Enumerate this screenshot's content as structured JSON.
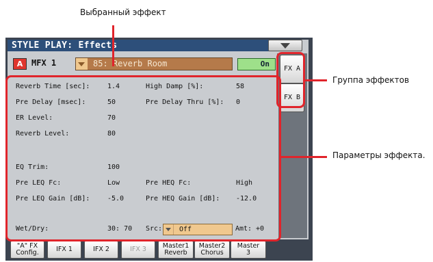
{
  "callouts": {
    "selected_effect": "Выбранный эффект",
    "effects_group": "Группа эффектов",
    "effect_params": "Параметры эффекта."
  },
  "window": {
    "title": "STYLE PLAY: Effects"
  },
  "effect_row": {
    "slot_button": "A",
    "mfx_label": "MFX 1",
    "effect_name": "85: Reverb Room",
    "on_label": "On"
  },
  "side_tabs": [
    "FX A",
    "FX B"
  ],
  "params": {
    "reverb_time_label": "Reverb Time [sec]:",
    "reverb_time_value": "1.4",
    "high_damp_label": "High Damp [%]:",
    "high_damp_value": "58",
    "pre_delay_label": "Pre Delay [msec]:",
    "pre_delay_value": "50",
    "pre_delay_thru_label": "Pre Delay Thru [%]:",
    "pre_delay_thru_value": "0",
    "er_level_label": "ER Level:",
    "er_level_value": "70",
    "reverb_level_label": "Reverb Level:",
    "reverb_level_value": "80",
    "eq_trim_label": "EQ Trim:",
    "eq_trim_value": "100",
    "pre_leq_fc_label": "Pre LEQ Fc:",
    "pre_leq_fc_value": "Low",
    "pre_heq_fc_label": "Pre HEQ Fc:",
    "pre_heq_fc_value": "High",
    "pre_leq_gain_label": "Pre LEQ Gain [dB]:",
    "pre_leq_gain_value": "-5.0",
    "pre_heq_gain_label": "Pre HEQ Gain [dB]:",
    "pre_heq_gain_value": "-12.0",
    "wet_dry_label": "Wet/Dry:",
    "wet_dry_value": "30: 70",
    "src_label": "Src:",
    "src_value": "Off",
    "amt_label": "Amt:",
    "amt_value": "+0"
  },
  "bottom_tabs": [
    {
      "line1": "\"A\" FX",
      "line2": "Config."
    },
    {
      "line1": "IFX 1",
      "line2": ""
    },
    {
      "line1": "IFX 2",
      "line2": ""
    },
    {
      "line1": "IFX 3",
      "line2": ""
    },
    {
      "line1": "Master1",
      "line2": "Reverb"
    },
    {
      "line1": "Master2",
      "line2": "Chorus"
    },
    {
      "line1": "Master",
      "line2": "3"
    }
  ],
  "colors": {
    "callout_red": "#e0242b",
    "title_bar": "#2d4f7a",
    "effect_selector": "#b57a4a",
    "on_button": "#9ee08a",
    "a_button": "#e0362e"
  }
}
